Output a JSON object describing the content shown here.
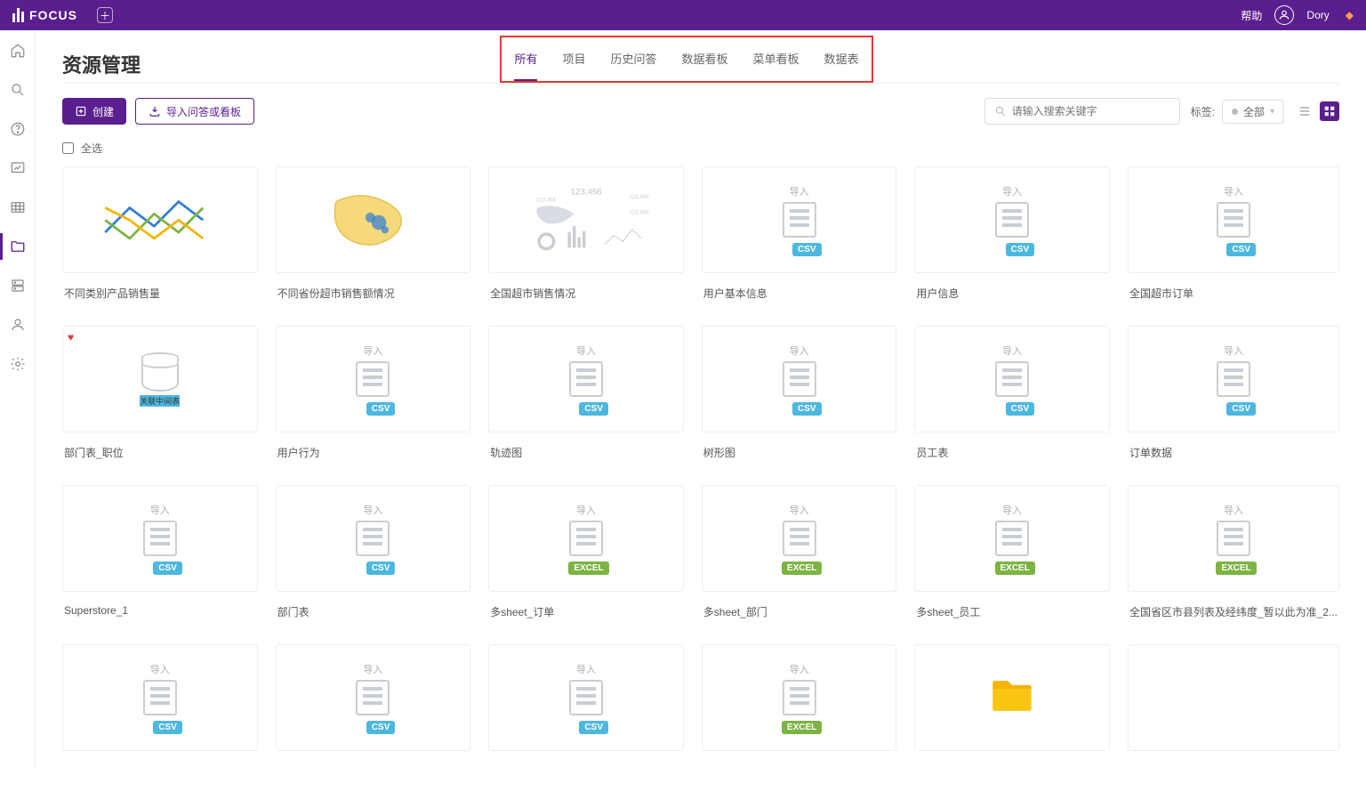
{
  "header": {
    "brand": "FOCUS",
    "help": "帮助",
    "user": "Dory"
  },
  "page": {
    "title": "资源管理",
    "create_label": "创建",
    "import_label": "导入问答或看板",
    "search_placeholder": "请输入搜索关键字",
    "tag_label": "标签:",
    "tag_all": "全部",
    "select_all": "全选"
  },
  "tabs": [
    {
      "id": "all",
      "label": "所有",
      "active": true
    },
    {
      "id": "project",
      "label": "项目",
      "active": false
    },
    {
      "id": "history",
      "label": "历史问答",
      "active": false
    },
    {
      "id": "data-board",
      "label": "数据看板",
      "active": false
    },
    {
      "id": "menu-board",
      "label": "菜单看板",
      "active": false
    },
    {
      "id": "data-table",
      "label": "数据表",
      "active": false
    }
  ],
  "cards": [
    {
      "title": "不同类别产品销售量",
      "thumb": "chart-lines"
    },
    {
      "title": "不同省份超市销售额情况",
      "thumb": "chart-map"
    },
    {
      "title": "全国超市销售情况",
      "thumb": "chart-dashboard"
    },
    {
      "title": "用户基本信息",
      "thumb": "csv",
      "import_label": "导入"
    },
    {
      "title": "用户信息",
      "thumb": "csv",
      "import_label": "导入"
    },
    {
      "title": "全国超市订单",
      "thumb": "csv",
      "import_label": "导入"
    },
    {
      "title": "部门表_职位",
      "thumb": "rel",
      "rel_label": "关联中间表",
      "fav": true
    },
    {
      "title": "用户行为",
      "thumb": "csv",
      "import_label": "导入"
    },
    {
      "title": "轨迹图",
      "thumb": "csv",
      "import_label": "导入"
    },
    {
      "title": "树形图",
      "thumb": "csv",
      "import_label": "导入"
    },
    {
      "title": "员工表",
      "thumb": "csv",
      "import_label": "导入"
    },
    {
      "title": "订单数据",
      "thumb": "csv",
      "import_label": "导入"
    },
    {
      "title": "Superstore_1",
      "thumb": "csv",
      "import_label": "导入"
    },
    {
      "title": "部门表",
      "thumb": "csv",
      "import_label": "导入"
    },
    {
      "title": "多sheet_订单",
      "thumb": "excel",
      "import_label": "导入"
    },
    {
      "title": "多sheet_部门",
      "thumb": "excel",
      "import_label": "导入"
    },
    {
      "title": "多sheet_员工",
      "thumb": "excel",
      "import_label": "导入"
    },
    {
      "title": "全国省区市县列表及经纬度_暂以此为准_2...",
      "thumb": "excel",
      "import_label": "导入"
    },
    {
      "title": "",
      "thumb": "csv",
      "import_label": "导入"
    },
    {
      "title": "",
      "thumb": "csv",
      "import_label": "导入"
    },
    {
      "title": "",
      "thumb": "csv",
      "import_label": "导入"
    },
    {
      "title": "",
      "thumb": "excel",
      "import_label": "导入"
    },
    {
      "title": "",
      "thumb": "folder"
    },
    {
      "title": "",
      "thumb": "blank"
    }
  ],
  "badges": {
    "csv": "CSV",
    "excel": "EXCEL"
  }
}
